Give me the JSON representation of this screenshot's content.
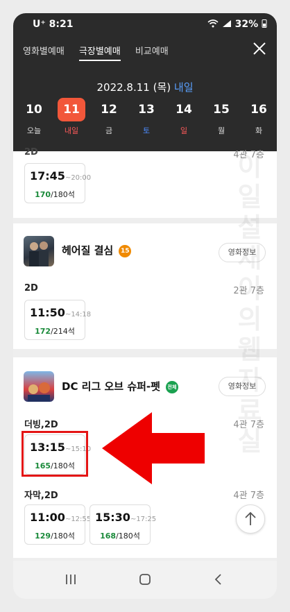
{
  "status": {
    "carrier_time": "U⁺ 8:21",
    "battery": "32%"
  },
  "tabs": [
    "영화별예매",
    "극장별예매",
    "비교예매"
  ],
  "date_header": {
    "date": "2022.8.11 (목)",
    "relative": "내일"
  },
  "days": [
    {
      "num": "10",
      "wk": "오늘"
    },
    {
      "num": "11",
      "wk": "내일"
    },
    {
      "num": "12",
      "wk": "금"
    },
    {
      "num": "13",
      "wk": "토"
    },
    {
      "num": "14",
      "wk": "일"
    },
    {
      "num": "15",
      "wk": "월"
    },
    {
      "num": "16",
      "wk": "화"
    }
  ],
  "partial": {
    "kind": "2D",
    "hall": "4관 7층",
    "start": "17:45",
    "end": "~20:00",
    "avail": "170",
    "total": "/180석"
  },
  "movie1": {
    "title": "헤어질 결심",
    "age": "15",
    "age_color": "#f08a00",
    "info": "영화정보",
    "kind": "2D",
    "hall": "2관 7층",
    "start": "11:50",
    "end": "~14:18",
    "avail": "172",
    "total": "/214석"
  },
  "movie2": {
    "title": "DC 리그 오브 슈퍼-펫",
    "age": "전체",
    "age_color": "#1aa150",
    "info": "영화정보",
    "group1": {
      "kind": "더빙,2D",
      "hall": "4관 7층",
      "start": "13:15",
      "end": "~15:10",
      "avail": "165",
      "total": "/180석"
    },
    "group2": {
      "kind": "자막,2D",
      "hall": "4관 7층",
      "slots": [
        {
          "start": "11:00",
          "end": "~12:55",
          "avail": "129",
          "total": "/180석"
        },
        {
          "start": "15:30",
          "end": "~17:25",
          "avail": "168",
          "total": "/180석"
        }
      ]
    }
  },
  "watermark": [
    "이",
    "일",
    "설",
    "재",
    "이",
    "의",
    "웹",
    "자",
    "료",
    "실"
  ]
}
